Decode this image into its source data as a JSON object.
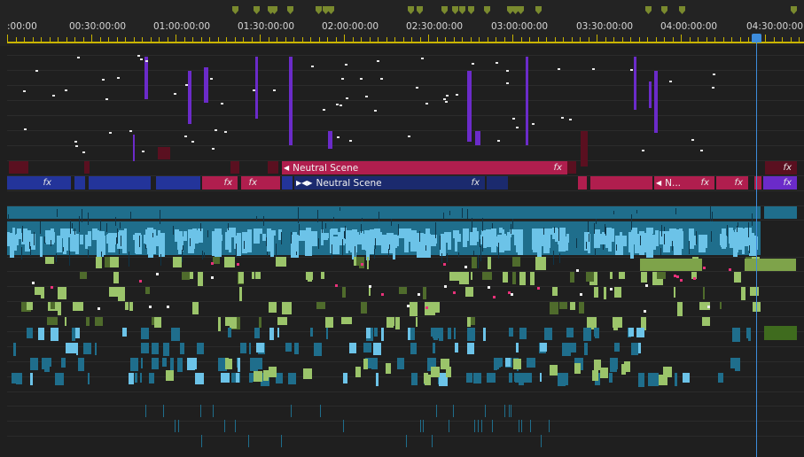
{
  "timeline": {
    "ruler_labels": [
      ":00:00",
      "00:30:00:00",
      "01:00:00:00",
      "01:30:00:00",
      "02:00:00:00",
      "02:30:00:00",
      "03:00:00:00",
      "03:30:00:00",
      "04:00:00:00",
      "04:30:00:00"
    ],
    "scene_labels": {
      "neutral_scene_top": "Neutral Scene",
      "neutral_scene_bottom": "Neutral Scene",
      "n_short": "N...",
      "fx": "fx"
    },
    "playhead_time": "04:30:00:00"
  },
  "colors": {
    "ruler_accent": "#c9b400",
    "marker": "#7a8a2e",
    "playhead": "#3d8cdc",
    "video_clip": "#1f6e8c",
    "video_clip_light": "#6cc3e8",
    "scene_red": "#b01e4e",
    "scene_blue": "#23349a",
    "purple": "#6b2bc9",
    "green_clip": "#9bc46a"
  }
}
